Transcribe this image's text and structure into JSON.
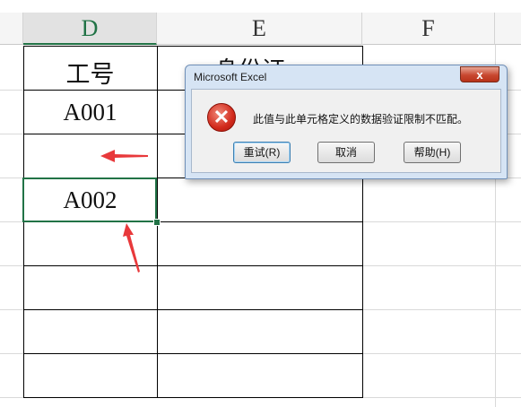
{
  "columns": {
    "d": "D",
    "e": "E",
    "f": "F"
  },
  "cells": {
    "d1": "工号",
    "d2": "A001",
    "d4": "A002",
    "e1_partial": "身份证"
  },
  "dialog": {
    "title": "Microsoft Excel",
    "close": "x",
    "message": "此值与此单元格定义的数据验证限制不匹配。",
    "icon": "error-icon",
    "buttons": {
      "retry": "重试(R)",
      "cancel": "取消",
      "help": "帮助(H)"
    }
  },
  "colors": {
    "accent": "#217346",
    "arrow": "#e8393b"
  }
}
